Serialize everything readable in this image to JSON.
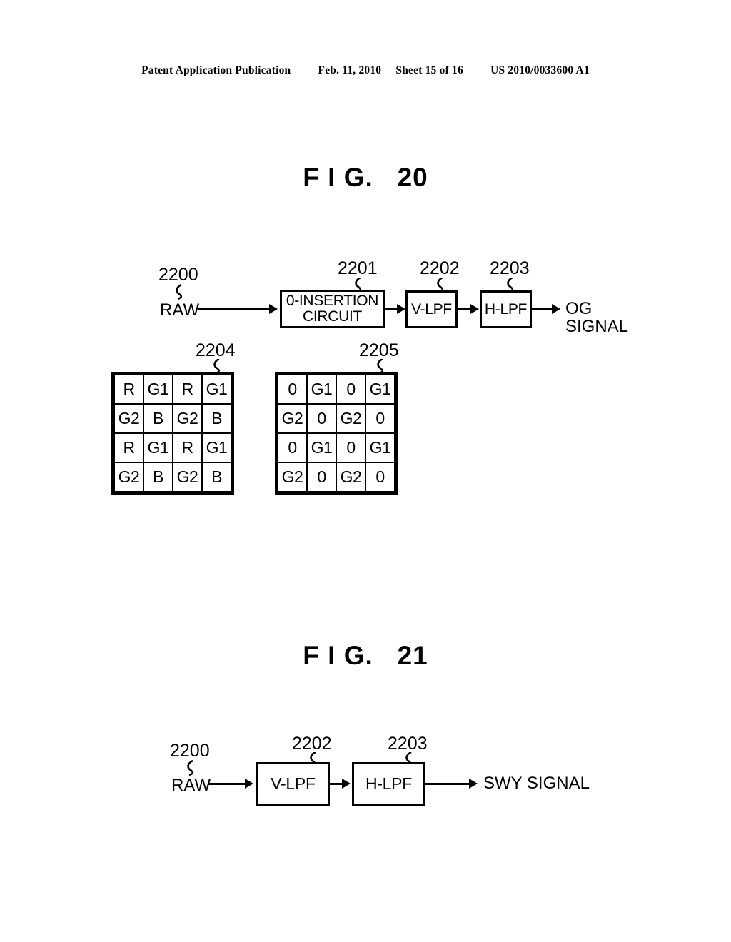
{
  "header": {
    "publication": "Patent Application Publication",
    "date": "Feb. 11, 2010",
    "sheet": "Sheet 15 of 16",
    "patent_number": "US 2010/0033600 A1"
  },
  "figures": [
    {
      "title": "F I G.   20",
      "input_ref": "2200",
      "input_label": "RAW",
      "blocks": [
        {
          "ref": "2201",
          "label": "0-INSERTION\nCIRCUIT"
        },
        {
          "ref": "2202",
          "label": "V-LPF"
        },
        {
          "ref": "2203",
          "label": "H-LPF"
        }
      ],
      "output_label": "OG\nSIGNAL",
      "matrices": [
        {
          "ref": "2204",
          "rows": [
            [
              "R",
              "G1",
              "R",
              "G1"
            ],
            [
              "G2",
              "B",
              "G2",
              "B"
            ],
            [
              "R",
              "G1",
              "R",
              "G1"
            ],
            [
              "G2",
              "B",
              "G2",
              "B"
            ]
          ]
        },
        {
          "ref": "2205",
          "rows": [
            [
              "0",
              "G1",
              "0",
              "G1"
            ],
            [
              "G2",
              "0",
              "G2",
              "0"
            ],
            [
              "0",
              "G1",
              "0",
              "G1"
            ],
            [
              "G2",
              "0",
              "G2",
              "0"
            ]
          ]
        }
      ]
    },
    {
      "title": "F I G.   21",
      "input_ref": "2200",
      "input_label": "RAW",
      "blocks": [
        {
          "ref": "2202",
          "label": "V-LPF"
        },
        {
          "ref": "2203",
          "label": "H-LPF"
        }
      ],
      "output_label": "SWY SIGNAL"
    }
  ]
}
